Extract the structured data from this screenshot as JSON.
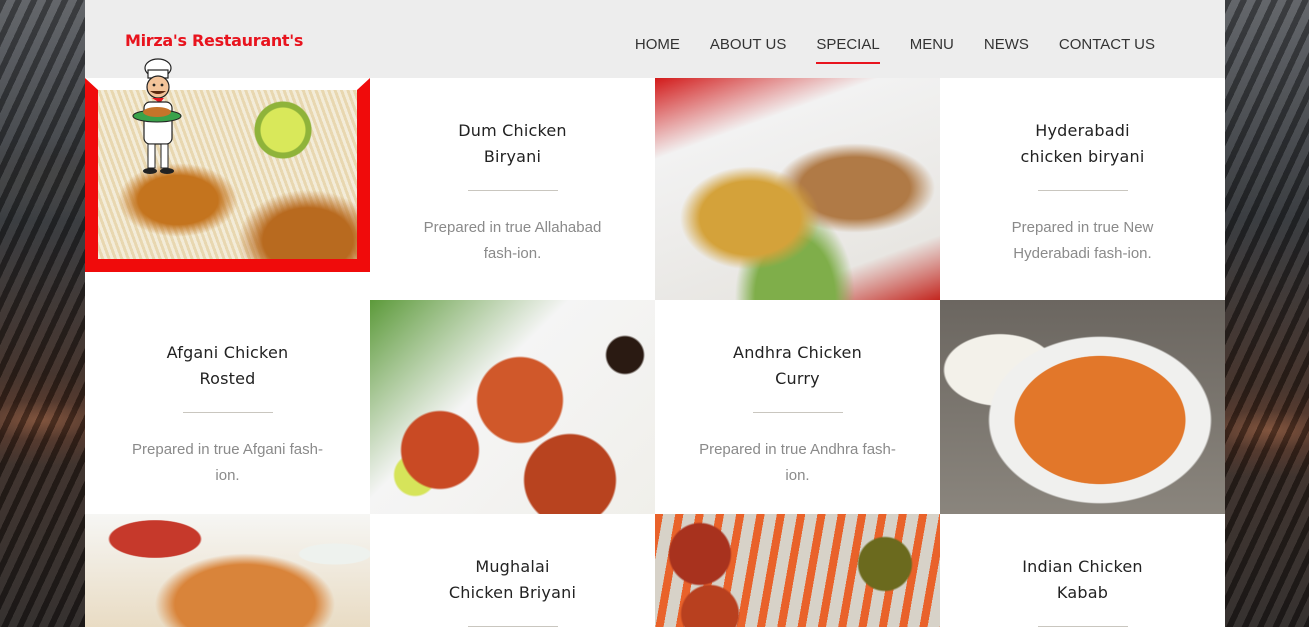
{
  "header": {
    "brand": "Mirza's Restaurant's",
    "nav": [
      {
        "label": "HOME",
        "active": false
      },
      {
        "label": "ABOUT US",
        "active": false
      },
      {
        "label": "SPECIAL",
        "active": true
      },
      {
        "label": "MENU",
        "active": false
      },
      {
        "label": "NEWS",
        "active": false
      },
      {
        "label": "CONTACT US",
        "active": false
      }
    ]
  },
  "dishes": [
    {
      "title_line1": "Dum Chicken",
      "title_line2": "Biryani",
      "desc_line1": "Prepared in true Allahabad",
      "desc_line2": "fash-ion."
    },
    {
      "title_line1": "Hyderabadi",
      "title_line2": "chicken biryani",
      "desc_line1": "Prepared in true New",
      "desc_line2": "Hyderabadi fash-ion."
    },
    {
      "title_line1": "Afgani Chicken",
      "title_line2": "Rosted",
      "desc_line1": "Prepared in true Afgani fash-ion.",
      "desc_line2": ""
    },
    {
      "title_line1": "Andhra Chicken",
      "title_line2": "Curry",
      "desc_line1": "Prepared in true Andhra fash-ion.",
      "desc_line2": ""
    },
    {
      "title_line1": "Mughalai",
      "title_line2": "Chicken Briyani",
      "desc_line1": "",
      "desc_line2": ""
    },
    {
      "title_line1": "Indian Chicken",
      "title_line2": "Kabab",
      "desc_line1": "",
      "desc_line2": ""
    }
  ],
  "colors": {
    "brand_red": "#e8141e",
    "nav_text": "#333333",
    "desc_text": "#8a8a8a"
  },
  "icons": {
    "chef": "chef-mascot-icon"
  }
}
